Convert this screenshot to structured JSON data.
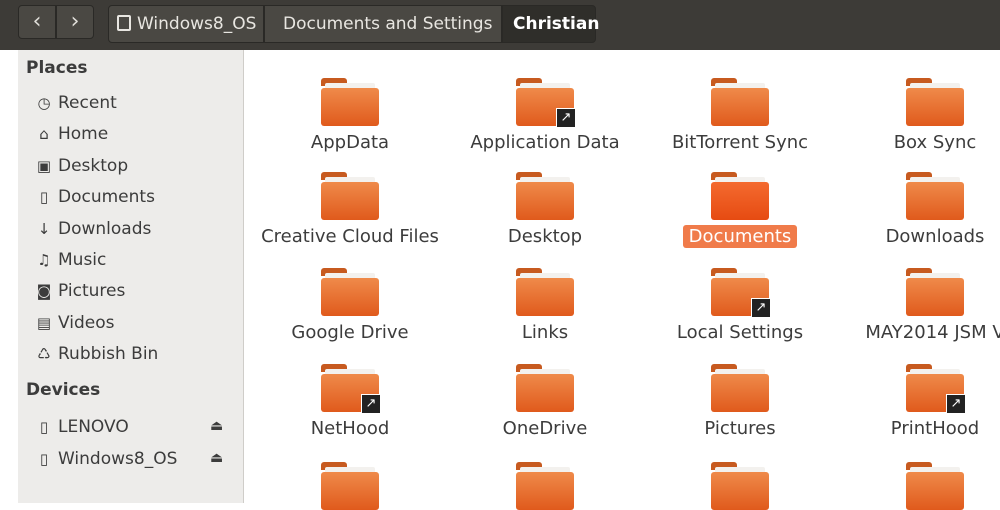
{
  "pathbar": {
    "back": "‹",
    "forward": "›",
    "crumbs": [
      "Windows8_OS",
      "Documents and Settings",
      "Christian"
    ]
  },
  "sidebar": {
    "places_title": "Places",
    "places": [
      {
        "label": "Recent",
        "icon": "clock-icon",
        "glyph": "◷"
      },
      {
        "label": "Home",
        "icon": "home-icon",
        "glyph": "⌂"
      },
      {
        "label": "Desktop",
        "icon": "desktop-folder-icon",
        "glyph": "▣"
      },
      {
        "label": "Documents",
        "icon": "document-icon",
        "glyph": "▯"
      },
      {
        "label": "Downloads",
        "icon": "download-icon",
        "glyph": "↓"
      },
      {
        "label": "Music",
        "icon": "music-icon",
        "glyph": "♫"
      },
      {
        "label": "Pictures",
        "icon": "camera-icon",
        "glyph": "◙"
      },
      {
        "label": "Videos",
        "icon": "film-icon",
        "glyph": "▤"
      },
      {
        "label": "Rubbish Bin",
        "icon": "trash-icon",
        "glyph": "♺"
      }
    ],
    "devices_title": "Devices",
    "devices": [
      {
        "label": "LENOVO",
        "icon": "drive-icon",
        "eject": "⏏"
      },
      {
        "label": "Windows8_OS",
        "icon": "drive-icon",
        "eject": "⏏"
      }
    ]
  },
  "folders": [
    {
      "label": "AppData",
      "link": false
    },
    {
      "label": "Application Data",
      "link": true
    },
    {
      "label": "BitTorrent Sync",
      "link": false
    },
    {
      "label": "Box Sync",
      "link": false
    },
    {
      "label": "Creative Cloud Files",
      "link": false
    },
    {
      "label": "Desktop",
      "link": false
    },
    {
      "label": "Documents",
      "link": false,
      "selected": true
    },
    {
      "label": "Downloads",
      "link": false
    },
    {
      "label": "Google Drive",
      "link": false
    },
    {
      "label": "Links",
      "link": false
    },
    {
      "label": "Local Settings",
      "link": true
    },
    {
      "label": "MAY2014 JSM V",
      "link": false
    },
    {
      "label": "NetHood",
      "link": true
    },
    {
      "label": "OneDrive",
      "link": false
    },
    {
      "label": "Pictures",
      "link": false
    },
    {
      "label": "PrintHood",
      "link": true
    }
  ],
  "colors": {
    "topbar": "#3d3b37",
    "accent": "#f07b4a",
    "folder": "#e9672b"
  }
}
